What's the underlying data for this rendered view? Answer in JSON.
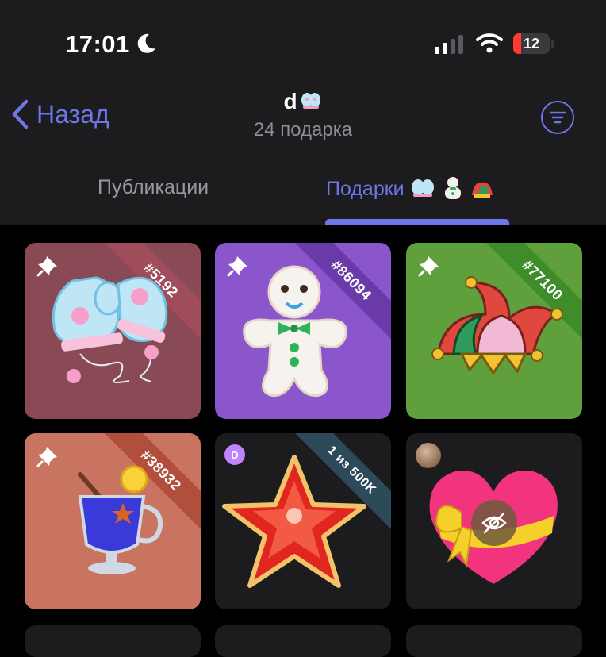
{
  "status_bar": {
    "time": "17:01",
    "battery_level": "12",
    "icons": [
      "moon-icon",
      "signal-icon",
      "wifi-icon",
      "battery-icon"
    ]
  },
  "nav": {
    "back_label": "Назад",
    "title": "d",
    "subtitle": "24 подарка",
    "filter_icon": "filter-icon"
  },
  "tabs": [
    {
      "label": "Публикации",
      "active": false
    },
    {
      "label": "Подарки",
      "active": true
    }
  ],
  "accent_color": "#6e76e8",
  "gifts": [
    {
      "name": "mittens",
      "badge": "#5192",
      "pinned": true,
      "bg": "#8a4a55",
      "ribbon_color": "#a04d5b"
    },
    {
      "name": "gingerbread-man",
      "badge": "#86094",
      "pinned": true,
      "bg": "#8b55cc",
      "ribbon_color": "#6a3aa8"
    },
    {
      "name": "jester-hat",
      "badge": "#77100",
      "pinned": true,
      "bg": "#5fa03d",
      "ribbon_color": "#3f8d2a"
    },
    {
      "name": "mulled-wine",
      "badge": "#38932",
      "pinned": true,
      "bg": "#c87460",
      "ribbon_color": "#b24e3c"
    },
    {
      "name": "red-star",
      "badge": "1 из 500K",
      "sender_initial": "D",
      "bg": "#1c1c1e"
    },
    {
      "name": "heart-with-bow",
      "hidden": true,
      "bg": "#1c1c1e"
    }
  ]
}
